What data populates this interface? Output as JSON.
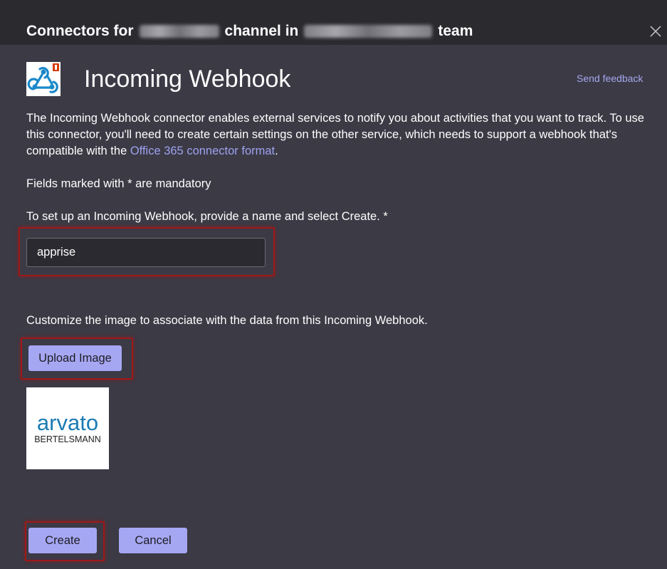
{
  "header": {
    "title_prefix": "Connectors for",
    "title_middle": "channel in",
    "title_suffix": "team"
  },
  "connector": {
    "name": "Incoming Webhook",
    "send_feedback": "Send feedback",
    "icon": "incoming-webhook-icon"
  },
  "description": {
    "part1": "The Incoming Webhook connector enables external services to notify you about activities that you want to track. To use this connector, you'll need to create certain settings on the other service, which needs to support a webhook that's compatible with the ",
    "link": "Office 365 connector format",
    "part2": "."
  },
  "mandatory_note": "Fields marked with * are mandatory",
  "name_field": {
    "label": "To set up an Incoming Webhook, provide a name and select Create. *",
    "value": "apprise"
  },
  "image_section": {
    "label": "Customize the image to associate with the data from this Incoming Webhook.",
    "upload_button": "Upload Image",
    "preview_logo_main": "arvato",
    "preview_logo_sub": "BERTELSMANN"
  },
  "actions": {
    "create": "Create",
    "cancel": "Cancel"
  },
  "colors": {
    "background": "#3b3a45",
    "header": "#2a2a2f",
    "accent_button": "#a6a7f3",
    "link": "#9ea2f0",
    "highlight": "#a01818",
    "logo_blue": "#1b7bb3"
  }
}
